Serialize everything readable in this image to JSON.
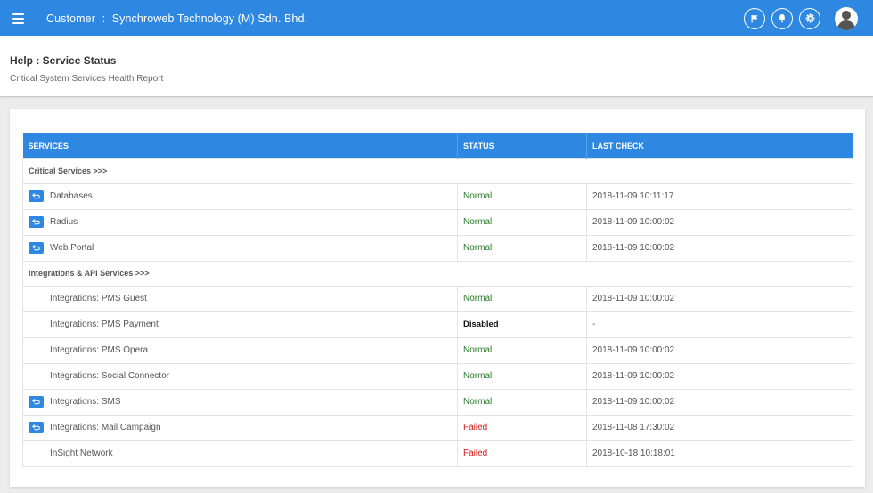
{
  "header": {
    "customer_label": "Customer",
    "separator": ":",
    "customer_name": "Synchroweb Technology (M) Sdn. Bhd."
  },
  "page": {
    "title": "Help : Service Status",
    "subtitle": "Critical System Services Health Report"
  },
  "table": {
    "columns": [
      "SERVICES",
      "STATUS",
      "LAST CHECK"
    ],
    "sections": [
      {
        "label": "Critical Services >>>",
        "rows": [
          {
            "name": "Databases",
            "status": "Normal",
            "last_check": "2018-11-09 10:11:17",
            "action": true
          },
          {
            "name": "Radius",
            "status": "Normal",
            "last_check": "2018-11-09 10:00:02",
            "action": true
          },
          {
            "name": "Web Portal",
            "status": "Normal",
            "last_check": "2018-11-09 10:00:02",
            "action": true
          }
        ]
      },
      {
        "label": "Integrations & API Services >>>",
        "rows": [
          {
            "name": "Integrations: PMS Guest",
            "status": "Normal",
            "last_check": "2018-11-09 10:00:02",
            "action": false
          },
          {
            "name": "Integrations: PMS Payment",
            "status": "Disabled",
            "last_check": "-",
            "action": false
          },
          {
            "name": "Integrations: PMS Opera",
            "status": "Normal",
            "last_check": "2018-11-09 10:00:02",
            "action": false
          },
          {
            "name": "Integrations: Social Connector",
            "status": "Normal",
            "last_check": "2018-11-09 10:00:02",
            "action": false
          },
          {
            "name": "Integrations: SMS",
            "status": "Normal",
            "last_check": "2018-11-09 10:00:02",
            "action": true
          },
          {
            "name": "Integrations: Mail Campaign",
            "status": "Failed",
            "last_check": "2018-11-08 17:30:02",
            "action": true
          },
          {
            "name": "InSight Network",
            "status": "Failed",
            "last_check": "2018-10-18 10:18:01",
            "action": false
          }
        ]
      }
    ]
  },
  "icons": {
    "menu": "hamburger-menu-icon",
    "flag": "flag-icon",
    "bell": "bell-icon",
    "gear": "gear-icon",
    "user": "user-avatar-icon",
    "row_action": "return-arrow-icon"
  },
  "colors": {
    "brand": "#2e87e0",
    "normal": "#2a7a2a",
    "failed": "#d21b1b",
    "disabled": "#111111"
  }
}
